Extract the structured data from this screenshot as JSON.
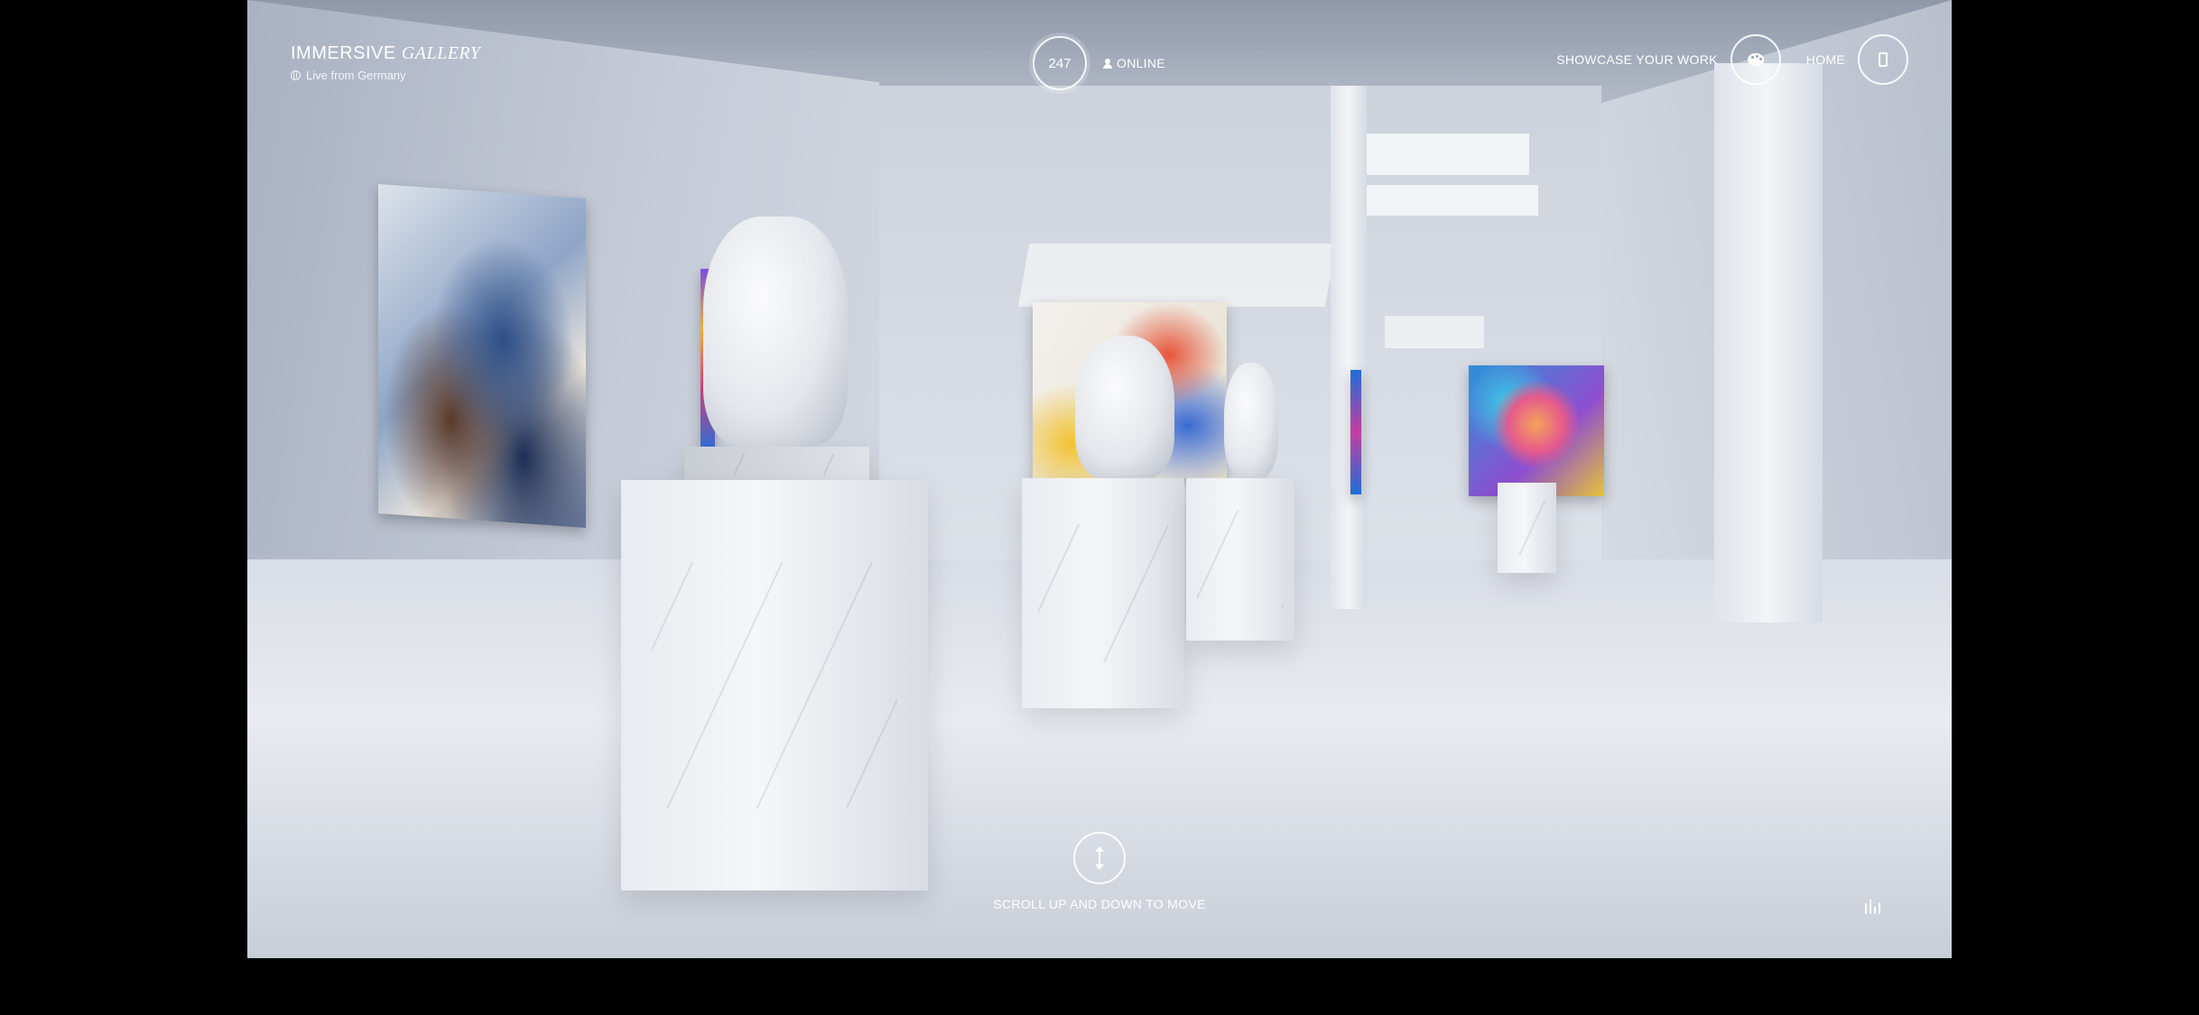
{
  "brand": {
    "title_main": "IMMERSIVE",
    "title_accent": "GALLERY",
    "subtitle": "Live from Germany"
  },
  "online": {
    "count": "247",
    "label": "ONLINE"
  },
  "nav": {
    "showcase_label": "SHOWCASE YOUR WORK",
    "home_label": "HOME"
  },
  "hint": {
    "scroll_text": "SCROLL UP AND DOWN TO MOVE"
  },
  "icons": {
    "globe": "globe-icon",
    "user": "user-icon",
    "palette": "palette-icon",
    "phone": "phone-icon",
    "scroll": "up-down-arrows-icon",
    "sound": "sound-bars-icon"
  }
}
